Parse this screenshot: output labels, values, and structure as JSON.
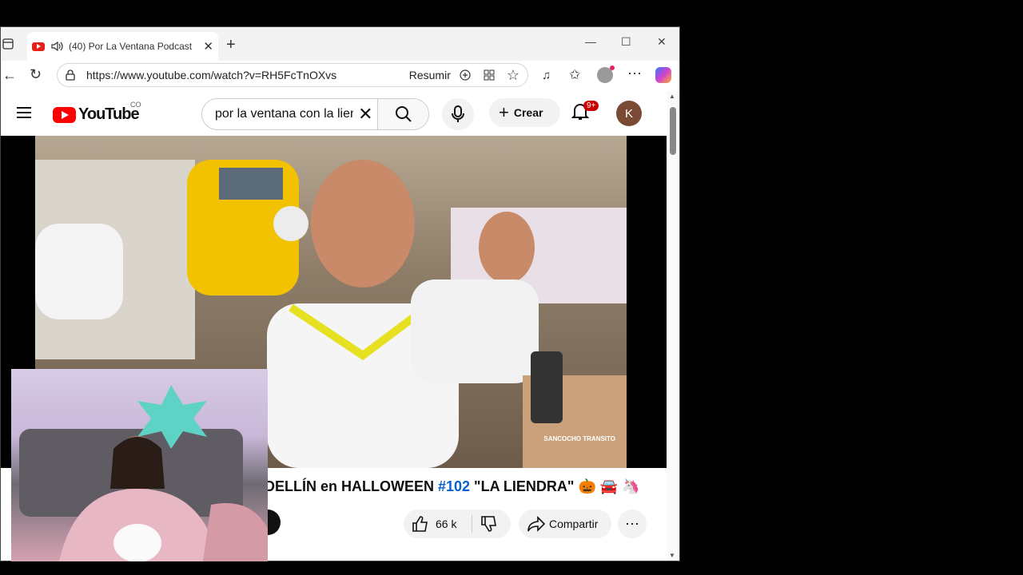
{
  "browser": {
    "tab_title": "(40) Por La Ventana Podcast",
    "url": "https://www.youtube.com/watch?v=RH5FcTnOXvs",
    "resumir": "Resumir"
  },
  "youtube": {
    "logo_text": "YouTube",
    "country_code": "CO",
    "search_query": "por la ventana con la lien",
    "create_label": "Crear",
    "notif_badge": "9+",
    "avatar_letter": "K"
  },
  "video": {
    "title_part1": "DELLÍN en HALLOWEEN ",
    "title_hash": "#102",
    "title_part2": " \"LA LIENDRA\" 🎃 🚘 🦄",
    "likes": "66 k",
    "share_label": "Compartir",
    "watermark": "SANCOCHO TRANSITO"
  }
}
